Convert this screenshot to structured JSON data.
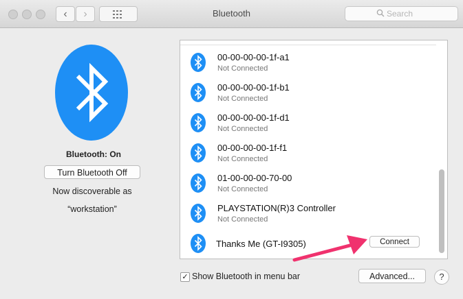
{
  "window": {
    "title": "Bluetooth",
    "search_placeholder": "Search",
    "nav_back": "‹",
    "nav_forward": "›"
  },
  "left_panel": {
    "status": "Bluetooth: On",
    "toggle_button": "Turn Bluetooth Off",
    "discoverable_line1": "Now discoverable as",
    "discoverable_line2": "“workstation”"
  },
  "devices": [
    {
      "name": "00-00-00-00-1f-a1",
      "status": "Not Connected"
    },
    {
      "name": "00-00-00-00-1f-b1",
      "status": "Not Connected"
    },
    {
      "name": "00-00-00-00-1f-d1",
      "status": "Not Connected"
    },
    {
      "name": "00-00-00-00-1f-f1",
      "status": "Not Connected"
    },
    {
      "name": "01-00-00-00-70-00",
      "status": "Not Connected"
    },
    {
      "name": "PLAYSTATION(R)3 Controller",
      "status": "Not Connected"
    },
    {
      "name": "Thanks Me (GT-I9305)",
      "action": "Connect"
    }
  ],
  "footer": {
    "show_in_menu_bar_label": "Show Bluetooth in menu bar",
    "show_in_menu_bar_checked": true,
    "checkmark": "✓",
    "advanced_button": "Advanced...",
    "help_button": "?"
  },
  "colors": {
    "bluetooth_blue": "#1e8ff5",
    "arrow_pink": "#f0326e"
  },
  "icons": [
    "bluetooth-icon",
    "search-icon",
    "grid-icon",
    "help-icon"
  ]
}
